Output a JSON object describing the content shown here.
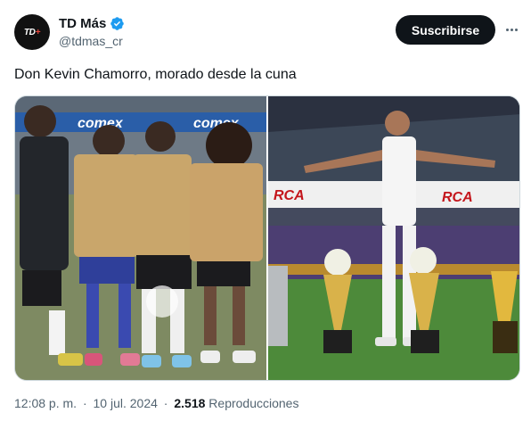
{
  "account": {
    "display_name": "TD Más",
    "handle": "@tdmas_cr",
    "avatar_text": "TD",
    "avatar_accent": "+"
  },
  "actions": {
    "subscribe_label": "Suscribirse"
  },
  "tweet": {
    "text": "Don Kevin Chamorro, morado desde la cuna"
  },
  "media": {
    "left_banner_text": "comex",
    "right_banner_text": "RCA",
    "right_banner_text_2": "RCA"
  },
  "meta": {
    "time": "12:08 p. m.",
    "separator": "·",
    "date": "10 jul. 2024",
    "views_count": "2.518",
    "views_label": "Reproducciones"
  },
  "colors": {
    "text_primary": "#0f1419",
    "text_secondary": "#536471",
    "verified_blue": "#1d9bf0",
    "border": "#cfd9de",
    "jersey_gold": "#c9a66b",
    "stadium_purple": "#5a2d82"
  }
}
